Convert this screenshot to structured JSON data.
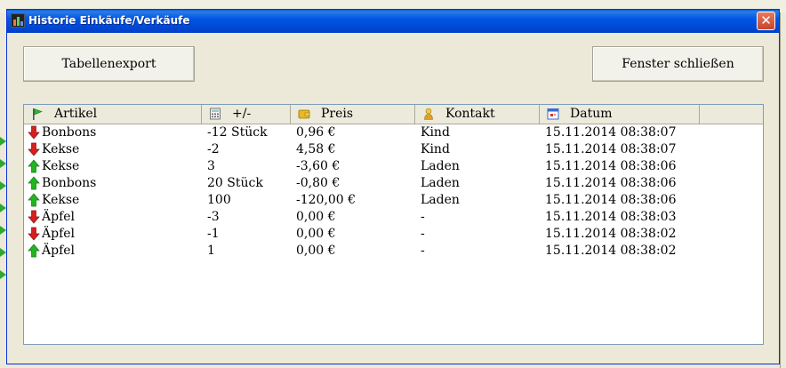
{
  "window": {
    "title": "Historie Einkäufe/Verkäufe",
    "close_glyph": "✕"
  },
  "toolbar": {
    "export_label": "Tabellenexport",
    "close_label": "Fenster schließen"
  },
  "table": {
    "columns": [
      {
        "label": "Artikel",
        "icon": "flag-icon"
      },
      {
        "label": "+/-",
        "icon": "calculator-icon"
      },
      {
        "label": "Preis",
        "icon": "wallet-icon"
      },
      {
        "label": "Kontakt",
        "icon": "person-icon"
      },
      {
        "label": "Datum",
        "icon": "calendar-icon"
      }
    ],
    "rows": [
      {
        "direction": "down",
        "artikel": "Bonbons",
        "menge": "-12 Stück",
        "preis": "0,96 €",
        "kontakt": "Kind",
        "datum": "15.11.2014 08:38:07"
      },
      {
        "direction": "down",
        "artikel": "Kekse",
        "menge": "-2",
        "preis": "4,58 €",
        "kontakt": "Kind",
        "datum": "15.11.2014 08:38:07"
      },
      {
        "direction": "up",
        "artikel": "Kekse",
        "menge": "3",
        "preis": "-3,60 €",
        "kontakt": "Laden",
        "datum": "15.11.2014 08:38:06"
      },
      {
        "direction": "up",
        "artikel": "Bonbons",
        "menge": "20 Stück",
        "preis": "-0,80 €",
        "kontakt": "Laden",
        "datum": "15.11.2014 08:38:06"
      },
      {
        "direction": "up",
        "artikel": "Kekse",
        "menge": "100",
        "preis": "-120,00 €",
        "kontakt": "Laden",
        "datum": "15.11.2014 08:38:06"
      },
      {
        "direction": "down",
        "artikel": "Äpfel",
        "menge": "-3",
        "preis": "0,00 €",
        "kontakt": "-",
        "datum": "15.11.2014 08:38:03"
      },
      {
        "direction": "down",
        "artikel": "Äpfel",
        "menge": "-1",
        "preis": "0,00 €",
        "kontakt": "-",
        "datum": "15.11.2014 08:38:02"
      },
      {
        "direction": "up",
        "artikel": "Äpfel",
        "menge": "1",
        "preis": "0,00 €",
        "kontakt": "-",
        "datum": "15.11.2014 08:38:02"
      }
    ]
  },
  "colors": {
    "arrow_up": "#22b422",
    "arrow_down": "#d42020",
    "titlebar": "#0055e5"
  }
}
